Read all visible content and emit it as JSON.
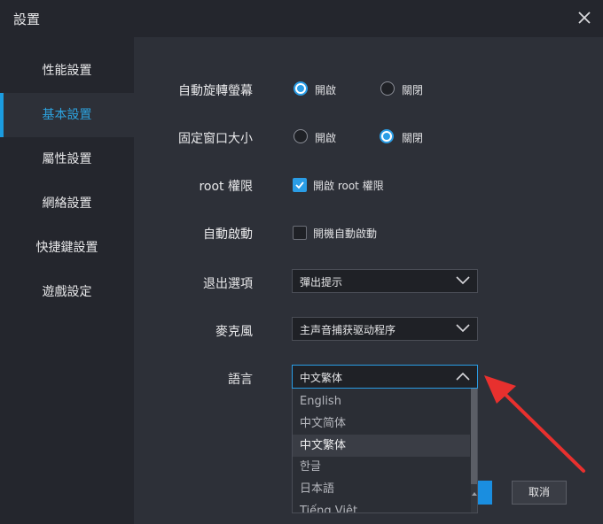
{
  "window": {
    "title": "設置"
  },
  "sidebar": {
    "items": [
      {
        "label": "性能設置"
      },
      {
        "label": "基本設置"
      },
      {
        "label": "屬性設置"
      },
      {
        "label": "網絡設置"
      },
      {
        "label": "快捷鍵設置"
      },
      {
        "label": "遊戲設定"
      }
    ]
  },
  "settings": {
    "auto_rotate": {
      "label": "自動旋轉螢幕",
      "opt_on": "開啟",
      "opt_off": "關閉"
    },
    "fixed_window": {
      "label": "固定窗口大小",
      "opt_on": "開啟",
      "opt_off": "關閉"
    },
    "root": {
      "label": "root 權限",
      "option": "開啟 root 權限"
    },
    "autostart": {
      "label": "自動啟動",
      "option": "開機自動啟動"
    },
    "exit_option": {
      "label": "退出選項",
      "value": "彈出提示"
    },
    "microphone": {
      "label": "麥克風",
      "value": "主声音捕获驱动程序"
    },
    "language": {
      "label": "語言",
      "value": "中文繁体",
      "options": [
        "English",
        "中文简体",
        "中文繁体",
        "한글",
        "日本語",
        "Tiếng Việt"
      ]
    }
  },
  "buttons": {
    "cancel": "取消"
  },
  "colors": {
    "accent": "#2a9de6",
    "annotation_arrow": "#e8302e"
  }
}
